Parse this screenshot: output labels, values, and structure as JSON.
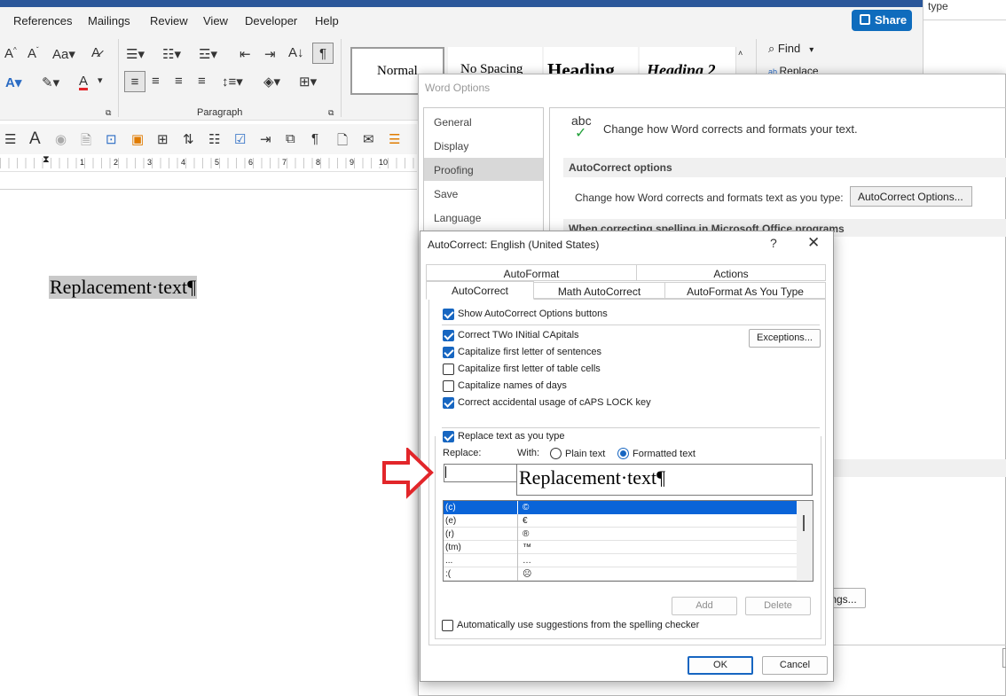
{
  "word": {
    "menu_tabs": [
      "References",
      "Mailings",
      "Review",
      "View",
      "Developer",
      "Help"
    ],
    "share_label": "Share",
    "right_panel_text": "type",
    "styles": [
      "Normal",
      "No Spacing",
      "Heading",
      "Heading 2"
    ],
    "find_label": "Find",
    "replace_label": "Replace",
    "paragraph_group": "Paragraph",
    "ruler_numbers": [
      "1",
      "2",
      "3",
      "4",
      "5",
      "6",
      "7",
      "8",
      "9",
      "10"
    ],
    "document_text": "Replacement·text¶"
  },
  "word_options": {
    "title": "Word Options",
    "nav": [
      "General",
      "Display",
      "Proofing",
      "Save",
      "Language"
    ],
    "selected_nav": "Proofing",
    "icon_text": "abc",
    "header_text": "Change how Word corrects and formats your text.",
    "section_autocorrect": "AutoCorrect options",
    "autocorrect_desc": "Change how Word corrects and formats text as you type:",
    "autocorrect_button": "AutoCorrect Options...",
    "section_spelling": "When correcting spelling in Microsoft Office programs",
    "partial_button": "ngs..."
  },
  "autocorrect": {
    "title": "AutoCorrect: English (United States)",
    "help": "?",
    "close": "✕",
    "tabs_top": [
      "AutoFormat",
      "Actions"
    ],
    "tabs_bottom": [
      "AutoCorrect",
      "Math AutoCorrect",
      "AutoFormat As You Type"
    ],
    "show_buttons": "Show AutoCorrect Options buttons",
    "options": [
      {
        "label": "Correct TWo INitial CApitals",
        "checked": true
      },
      {
        "label": "Capitalize first letter of sentences",
        "checked": true
      },
      {
        "label": "Capitalize first letter of table cells",
        "checked": false
      },
      {
        "label": "Capitalize names of days",
        "checked": false
      },
      {
        "label": "Correct accidental usage of cAPS LOCK key",
        "checked": true
      }
    ],
    "exceptions": "Exceptions...",
    "replace_as_type": "Replace text as you type",
    "replace_label": "Replace:",
    "with_label": "With:",
    "plain_text": "Plain text",
    "formatted_text": "Formatted text",
    "replace_value": "",
    "with_value": "Replacement·text¶",
    "list": [
      {
        "from": "(c)",
        "to": "©"
      },
      {
        "from": "(e)",
        "to": "€"
      },
      {
        "from": "(r)",
        "to": "®"
      },
      {
        "from": "(tm)",
        "to": "™"
      },
      {
        "from": "...",
        "to": "…"
      },
      {
        "from": ":(",
        "to": "☹"
      }
    ],
    "add": "Add",
    "delete": "Delete",
    "auto_suggest": "Automatically use suggestions from the spelling checker",
    "ok": "OK",
    "cancel": "Cancel"
  },
  "colors": {
    "accent": "#0f6cbd",
    "selection": "#0a64d8",
    "arrow": "#e2262a"
  }
}
